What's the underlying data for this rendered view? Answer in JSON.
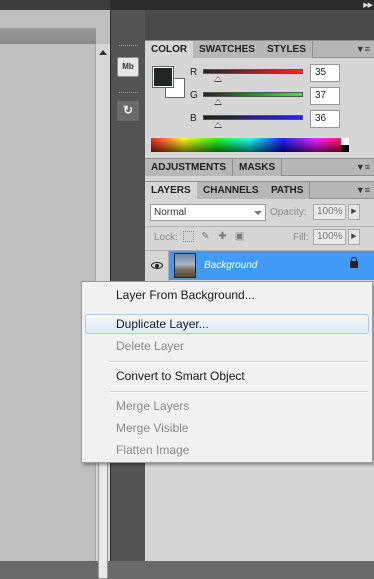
{
  "color_panel": {
    "tabs": [
      "COLOR",
      "SWATCHES",
      "STYLES"
    ],
    "channels": [
      {
        "label": "R",
        "value": "35"
      },
      {
        "label": "G",
        "value": "37"
      },
      {
        "label": "B",
        "value": "36"
      }
    ],
    "foreground_color": "#232524",
    "background_color": "#ffffff"
  },
  "adjustments_panel": {
    "tabs": [
      "ADJUSTMENTS",
      "MASKS"
    ]
  },
  "layers_panel": {
    "tabs": [
      "LAYERS",
      "CHANNELS",
      "PATHS"
    ],
    "blend_mode": "Normal",
    "opacity_label": "Opacity:",
    "opacity_value": "100%",
    "lock_label": "Lock:",
    "fill_label": "Fill:",
    "fill_value": "100%",
    "layers": [
      {
        "name": "Background",
        "visible": true,
        "locked": true,
        "selected": true
      }
    ]
  },
  "dock": {
    "mini_bridge_label": "Mb"
  },
  "context_menu": {
    "items": [
      {
        "label": "Layer From Background...",
        "enabled": true
      },
      {
        "label": "Duplicate Layer...",
        "enabled": true,
        "highlighted": true
      },
      {
        "label": "Delete Layer",
        "enabled": false
      },
      {
        "label": "Convert to Smart Object",
        "enabled": true
      },
      {
        "label": "Merge Layers",
        "enabled": false
      },
      {
        "label": "Merge Visible",
        "enabled": false
      },
      {
        "label": "Flatten Image",
        "enabled": false
      }
    ]
  },
  "colors": {
    "selection_blue": "#3f9bf5",
    "panel_bg": "#d6d6d6",
    "dock_bg": "#535353"
  }
}
